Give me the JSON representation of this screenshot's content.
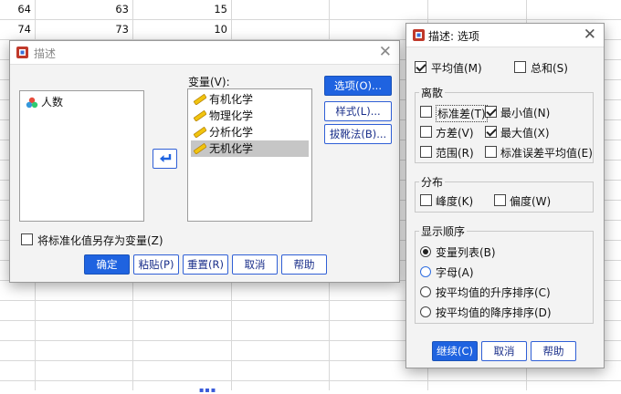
{
  "sheet": {
    "rows": [
      [
        "64",
        "63",
        "15"
      ],
      [
        "74",
        "73",
        "10"
      ]
    ]
  },
  "describe": {
    "title": "描述",
    "source_list": [
      "人数"
    ],
    "variables_label": "变量(V):",
    "variables": [
      "有机化学",
      "物理化学",
      "分析化学",
      "无机化学"
    ],
    "selected_variable_index": 3,
    "side_buttons": [
      "选项(O)...",
      "样式(L)...",
      "拔靴法(B)..."
    ],
    "save_std_label": "将标准化值另存为变量(Z)",
    "save_std_checked": false,
    "bottom_buttons": [
      "确定",
      "粘贴(P)",
      "重置(R)",
      "取消",
      "帮助"
    ]
  },
  "options": {
    "title": "描述: 选项",
    "mean_label": "平均值(M)",
    "mean_checked": true,
    "sum_label": "总和(S)",
    "sum_checked": false,
    "dispersion_title": "离散",
    "std_label": "标准差(T)",
    "std_checked": false,
    "min_label": "最小值(N)",
    "min_checked": true,
    "var_label": "方差(V)",
    "var_checked": false,
    "max_label": "最大值(X)",
    "max_checked": true,
    "range_label": "范围(R)",
    "range_checked": false,
    "sem_label": "标准误差平均值(E)",
    "sem_checked": false,
    "distribution_title": "分布",
    "kurtosis_label": "峰度(K)",
    "kurtosis_checked": false,
    "skew_label": "偏度(W)",
    "skew_checked": false,
    "order_title": "显示顺序",
    "order_options": [
      "变量列表(B)",
      "字母(A)",
      "按平均值的升序排序(C)",
      "按平均值的降序排序(D)"
    ],
    "order_selected": 0,
    "buttons": [
      "继续(C)",
      "取消",
      "帮助"
    ]
  },
  "colors": {
    "accent": "#1f63e0"
  }
}
